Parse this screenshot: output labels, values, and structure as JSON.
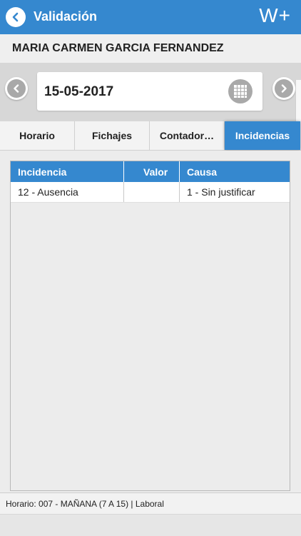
{
  "appbar": {
    "title": "Validación",
    "brand": "W+",
    "back_icon": "chevron-left-icon",
    "color": "#3588cf"
  },
  "employee": {
    "name": "MARIA CARMEN GARCIA FERNANDEZ"
  },
  "date_nav": {
    "date": "15-05-2017",
    "prev_icon": "chevron-left-icon",
    "next_icon": "chevron-right-icon",
    "calendar_icon": "calendar-grid-icon"
  },
  "tabs": [
    {
      "label": "Horario",
      "active": false
    },
    {
      "label": "Fichajes",
      "active": false
    },
    {
      "label": "Contador…",
      "active": false
    },
    {
      "label": "Incidencias",
      "active": true
    }
  ],
  "incidencias_table": {
    "columns": [
      "Incidencia",
      "Valor",
      "Causa"
    ],
    "rows": [
      {
        "incidencia": "12 - Ausencia",
        "valor": "",
        "causa": "1 - Sin justificar"
      }
    ]
  },
  "status_bar": {
    "text": "Horario: 007 - MAÑANA (7 A 15)  |  Laboral"
  }
}
